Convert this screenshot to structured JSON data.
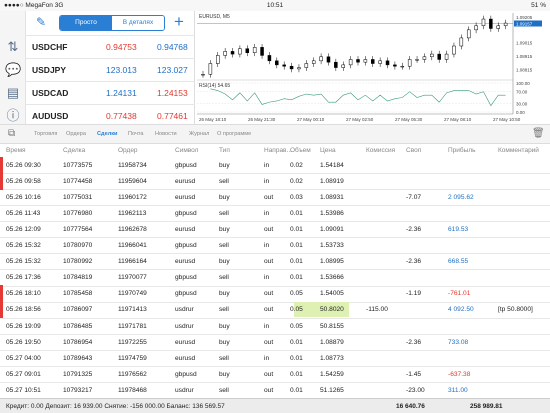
{
  "status": {
    "carrier": "●●●●○ MegaFon",
    "network": "3G",
    "time": "10:51",
    "battery": "51 %"
  },
  "icons": {
    "pencil": "pencil-icon",
    "plus": "plus-icon",
    "quotes": "quotes-icon",
    "chat": "chat-icon",
    "document": "document-icon",
    "info": "info-icon"
  },
  "quotes": {
    "seg_left": "Просто",
    "seg_right": "В деталях",
    "rows": [
      {
        "symbol": "USDCHF",
        "bid": "0.94753",
        "ask": "0.94768",
        "bid_color": "red",
        "ask_color": "blue"
      },
      {
        "symbol": "USDJPY",
        "bid": "123.013",
        "ask": "123.027",
        "bid_color": "blue",
        "ask_color": "blue"
      },
      {
        "symbol": "USDCAD",
        "bid": "1.24131",
        "ask": "1.24153",
        "bid_color": "blue",
        "ask_color": "red"
      },
      {
        "symbol": "AUDUSD",
        "bid": "0.77438",
        "ask": "0.77461",
        "bid_color": "red",
        "ask_color": "red"
      }
    ]
  },
  "chart": {
    "title": "EURUSD, M5",
    "rsi_label": "RSI(14) 54.65",
    "price_labels": [
      "1.09205",
      "1.09157",
      "1.09015",
      "1.08915",
      "1.08815"
    ],
    "rsi_levels": [
      "100.00",
      "70.00",
      "30.00",
      "0.00"
    ],
    "time_labels": [
      "26 May 18:10",
      "26 May 21:30",
      "27 May 00:10",
      "27 May 02:50",
      "27 May 05:30",
      "27 May 08:10",
      "27 May 10:50"
    ],
    "closes": [
      1.0878,
      1.0886,
      1.0892,
      1.0895,
      1.0893,
      1.0897,
      1.0894,
      1.0898,
      1.0892,
      1.0888,
      1.0885,
      1.0884,
      1.0882,
      1.0883,
      1.0886,
      1.0888,
      1.0891,
      1.0887,
      1.0883,
      1.0885,
      1.0889,
      1.0887,
      1.0889,
      1.0886,
      1.0888,
      1.0885,
      1.0884,
      1.0884,
      1.0889,
      1.0889,
      1.0891,
      1.0893,
      1.0889,
      1.0893,
      1.0899,
      1.0905,
      1.0911,
      1.0914,
      1.0919,
      1.0912,
      1.0914,
      1.0916
    ]
  },
  "tabs": [
    "Торговля",
    "Ордера",
    "Сделки",
    "Почта",
    "Новости",
    "Журнал",
    "О программе"
  ],
  "active_tab": "Сделки",
  "columns": {
    "time": "Время",
    "deal": "Сделка",
    "order": "Ордер",
    "symbol": "Символ",
    "type": "Тип",
    "direction": "Направ...",
    "volume": "Объем",
    "price": "Цена",
    "commission": "Комиссия",
    "swap": "Своп",
    "profit": "Прибыль",
    "comment": "Комментарий"
  },
  "deals": [
    {
      "time": "05.26 09:30",
      "deal": "10773575",
      "order": "11958734",
      "symbol": "gbpusd",
      "type": "buy",
      "dir": "in",
      "vol": "0.02",
      "price": "1.54184",
      "comm": "",
      "swap": "",
      "profit": "",
      "cmt": "",
      "mark": "#e53935"
    },
    {
      "time": "05.26 09:58",
      "deal": "10774458",
      "order": "11959604",
      "symbol": "eurusd",
      "type": "sell",
      "dir": "in",
      "vol": "0.02",
      "price": "1.08919",
      "comm": "",
      "swap": "",
      "profit": "",
      "cmt": "",
      "mark": "#e53935"
    },
    {
      "time": "05.26 10:16",
      "deal": "10775031",
      "order": "11960172",
      "symbol": "eurusd",
      "type": "buy",
      "dir": "out",
      "vol": "0.03",
      "price": "1.08931",
      "comm": "",
      "swap": "-7.07",
      "profit": "2 095.62",
      "cmt": "",
      "mark": ""
    },
    {
      "time": "05.26 11:43",
      "deal": "10776980",
      "order": "11962113",
      "symbol": "gbpusd",
      "type": "sell",
      "dir": "in",
      "vol": "0.01",
      "price": "1.53986",
      "comm": "",
      "swap": "",
      "profit": "",
      "cmt": "",
      "mark": ""
    },
    {
      "time": "05.26 12:09",
      "deal": "10777564",
      "order": "11962678",
      "symbol": "eurusd",
      "type": "buy",
      "dir": "out",
      "vol": "0.01",
      "price": "1.09091",
      "comm": "",
      "swap": "-2.36",
      "profit": "619.53",
      "cmt": "",
      "mark": ""
    },
    {
      "time": "05.26 15:32",
      "deal": "10780970",
      "order": "11966041",
      "symbol": "gbpusd",
      "type": "sell",
      "dir": "in",
      "vol": "0.01",
      "price": "1.53733",
      "comm": "",
      "swap": "",
      "profit": "",
      "cmt": "",
      "mark": ""
    },
    {
      "time": "05.26 15:32",
      "deal": "10780992",
      "order": "11966164",
      "symbol": "eurusd",
      "type": "buy",
      "dir": "out",
      "vol": "0.01",
      "price": "1.08995",
      "comm": "",
      "swap": "-2.36",
      "profit": "668.55",
      "cmt": "",
      "mark": ""
    },
    {
      "time": "05.26 17:36",
      "deal": "10784819",
      "order": "11970077",
      "symbol": "gbpusd",
      "type": "sell",
      "dir": "in",
      "vol": "0.01",
      "price": "1.53666",
      "comm": "",
      "swap": "",
      "profit": "",
      "cmt": "",
      "mark": ""
    },
    {
      "time": "05.26 18:10",
      "deal": "10785458",
      "order": "11970749",
      "symbol": "gbpusd",
      "type": "buy",
      "dir": "out",
      "vol": "0.05",
      "price": "1.54005",
      "comm": "",
      "swap": "-1.19",
      "profit": "-761.01",
      "cmt": "",
      "mark": "#e53935"
    },
    {
      "time": "05.26 18:56",
      "deal": "10786097",
      "order": "11971413",
      "symbol": "usdrur",
      "type": "sell",
      "dir": "out",
      "vol": "0.05",
      "price": "50.8020",
      "comm": "-115.00",
      "swap": "",
      "profit": "4 092.50",
      "cmt": "[tp 50.8000]",
      "mark": "#e53935",
      "hl": true
    },
    {
      "time": "05.26 19:09",
      "deal": "10786485",
      "order": "11971781",
      "symbol": "usdrur",
      "type": "buy",
      "dir": "in",
      "vol": "0.05",
      "price": "50.8155",
      "comm": "",
      "swap": "",
      "profit": "",
      "cmt": "",
      "mark": ""
    },
    {
      "time": "05.26 19:50",
      "deal": "10786954",
      "order": "11972255",
      "symbol": "eurusd",
      "type": "buy",
      "dir": "out",
      "vol": "0.01",
      "price": "1.08879",
      "comm": "",
      "swap": "-2.36",
      "profit": "733.08",
      "cmt": "",
      "mark": ""
    },
    {
      "time": "05.27 04:00",
      "deal": "10789643",
      "order": "11974759",
      "symbol": "eurusd",
      "type": "sell",
      "dir": "in",
      "vol": "0.01",
      "price": "1.08773",
      "comm": "",
      "swap": "",
      "profit": "",
      "cmt": "",
      "mark": ""
    },
    {
      "time": "05.27 09:01",
      "deal": "10791325",
      "order": "11976562",
      "symbol": "gbpusd",
      "type": "buy",
      "dir": "out",
      "vol": "0.01",
      "price": "1.54259",
      "comm": "",
      "swap": "-1.45",
      "profit": "-637.38",
      "cmt": "",
      "mark": ""
    },
    {
      "time": "05.27 10:51",
      "deal": "10793217",
      "order": "11978468",
      "symbol": "usdrur",
      "type": "sell",
      "dir": "out",
      "vol": "0.01",
      "price": "51.1265",
      "comm": "",
      "swap": "-23.00",
      "profit": "311.00",
      "cmt": "",
      "mark": ""
    }
  ],
  "footer": {
    "summary": "Кредит: 0.00 Депозит: 16 939.00 Снятие: -156 000.00 Баланс: 136 569.57",
    "total_swap": "16 640.76",
    "total_profit": "258 989.81"
  }
}
